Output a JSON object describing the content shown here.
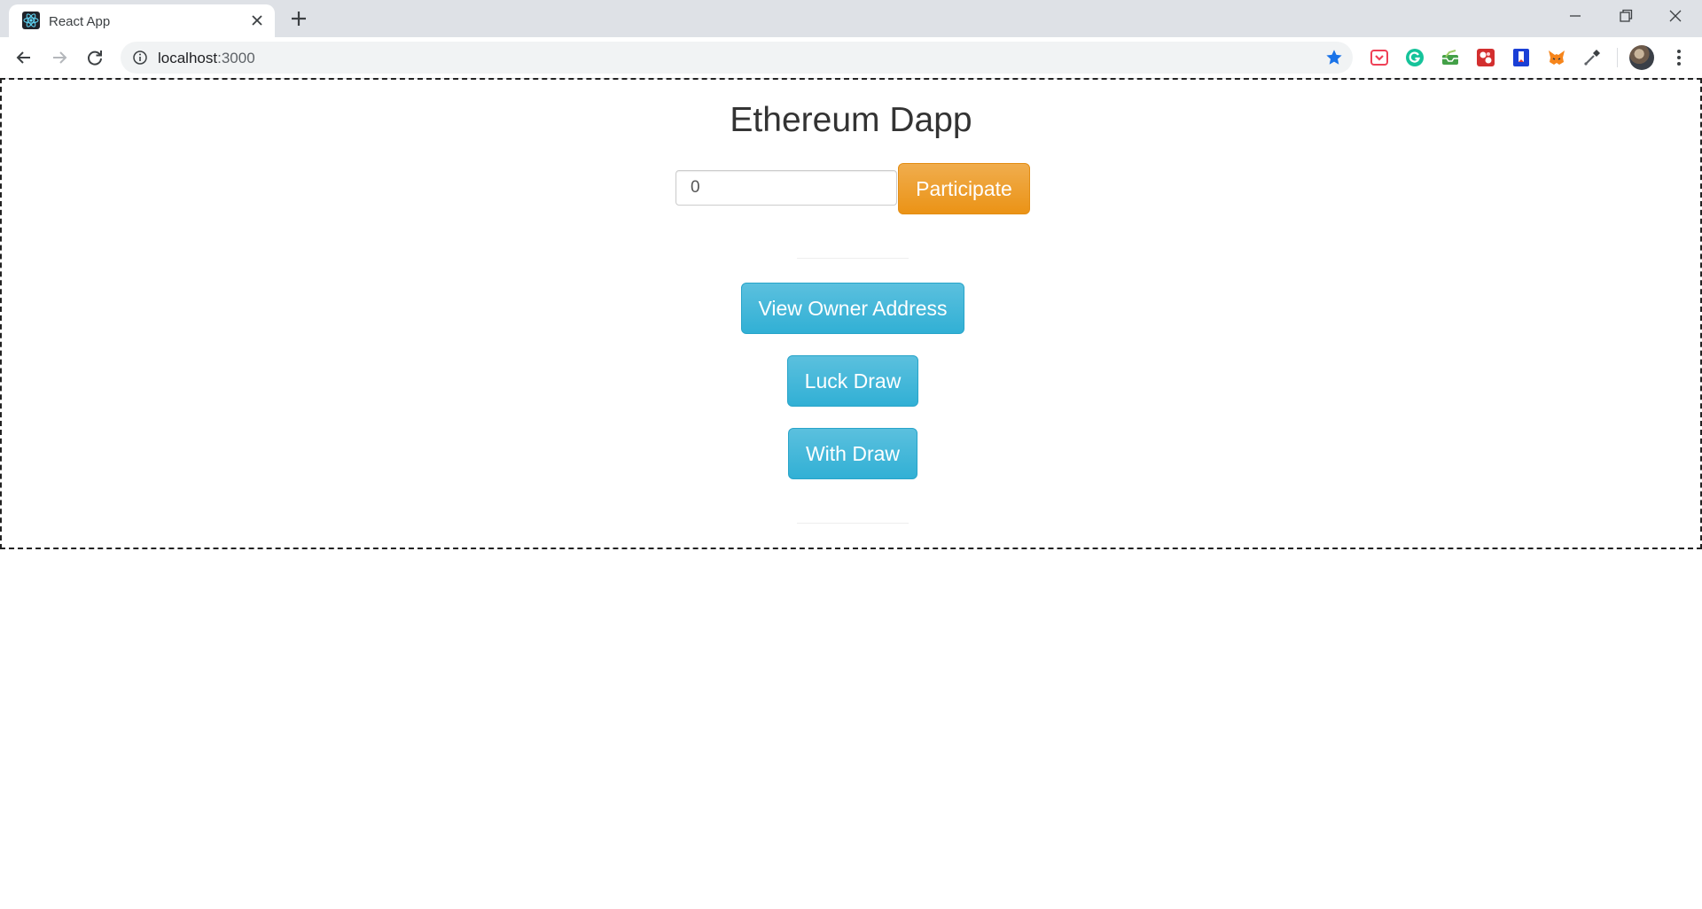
{
  "browser": {
    "tab": {
      "title": "React App"
    },
    "address_bar": {
      "host": "localhost",
      "port": ":3000"
    },
    "extensions": [
      "pocket-icon",
      "grammarly-icon",
      "inbox-icon",
      "puzzle-game-icon",
      "bookmark-ext-icon",
      "metamask-icon",
      "eyedropper-icon"
    ]
  },
  "app": {
    "title": "Ethereum Dapp",
    "amount_input": {
      "value": "0"
    },
    "participate_label": "Participate",
    "view_owner_label": "View Owner Address",
    "luck_draw_label": "Luck Draw",
    "with_draw_label": "With Draw"
  },
  "colors": {
    "warning": "#f0ad4e",
    "info": "#5bc0de",
    "tabbar": "#dee1e6",
    "star": "#1a73e8"
  }
}
